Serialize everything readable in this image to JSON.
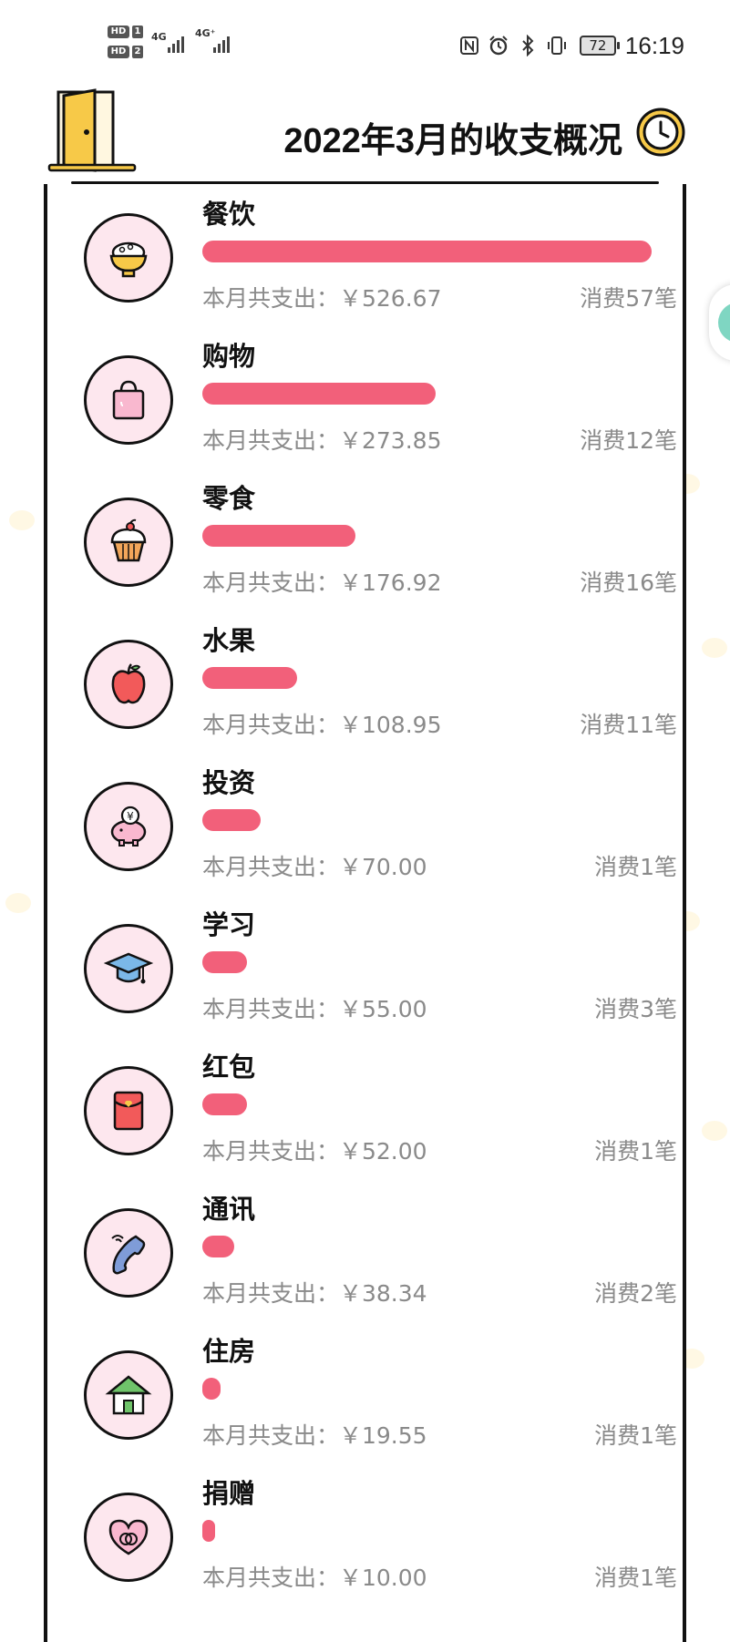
{
  "status_bar": {
    "sim1_label": "HD",
    "sim1_num": "1",
    "sim2_label": "HD",
    "sim2_num": "2",
    "net1": "4G",
    "net2": "4G⁺",
    "battery": "72",
    "time": "16:19",
    "icons": [
      "nfc-icon",
      "alarm-icon",
      "bluetooth-icon",
      "vibrate-icon"
    ]
  },
  "header": {
    "title": "2022年3月的收支概况",
    "left_icon": "door-icon",
    "right_icon": "clock-icon"
  },
  "colors": {
    "bar": "#f2607a",
    "icon_bg": "#fde7ee",
    "outline": "#111111",
    "muted_text": "#8a8a8a"
  },
  "categories": [
    {
      "name": "餐饮",
      "icon": "rice-bowl-icon",
      "total": "本月共支出：￥526.67",
      "count": "消费57笔",
      "share": 1.0
    },
    {
      "name": "购物",
      "icon": "shopping-bag-icon",
      "total": "本月共支出：￥273.85",
      "count": "消费12笔",
      "share": 0.52
    },
    {
      "name": "零食",
      "icon": "cupcake-icon",
      "total": "本月共支出：￥176.92",
      "count": "消费16笔",
      "share": 0.34
    },
    {
      "name": "水果",
      "icon": "apple-icon",
      "total": "本月共支出：￥108.95",
      "count": "消费11笔",
      "share": 0.21
    },
    {
      "name": "投资",
      "icon": "piggy-bank-icon",
      "total": "本月共支出：￥70.00",
      "count": "消费1笔",
      "share": 0.13
    },
    {
      "name": "学习",
      "icon": "graduation-cap-icon",
      "total": "本月共支出：￥55.00",
      "count": "消费3笔",
      "share": 0.1
    },
    {
      "name": "红包",
      "icon": "red-envelope-icon",
      "total": "本月共支出：￥52.00",
      "count": "消费1笔",
      "share": 0.1
    },
    {
      "name": "通讯",
      "icon": "phone-icon",
      "total": "本月共支出：￥38.34",
      "count": "消费2笔",
      "share": 0.07
    },
    {
      "name": "住房",
      "icon": "house-icon",
      "total": "本月共支出：￥19.55",
      "count": "消费1笔",
      "share": 0.04
    },
    {
      "name": "捐赠",
      "icon": "heart-icon",
      "total": "本月共支出：￥10.00",
      "count": "消费1笔",
      "share": 0.02
    }
  ]
}
